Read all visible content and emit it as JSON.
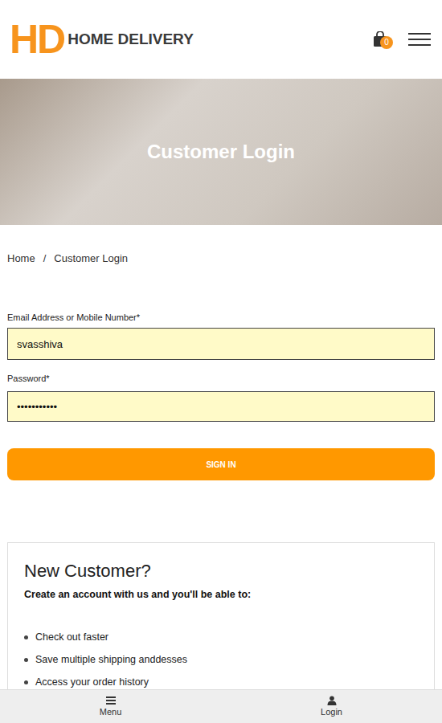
{
  "header": {
    "logo_mark": "HD",
    "brand": "HOME DELIVERY",
    "cart_count": "0"
  },
  "hero": {
    "title": "Customer Login"
  },
  "breadcrumb": {
    "separator": "/",
    "items": [
      {
        "label": "Home"
      },
      {
        "label": "Customer Login"
      }
    ]
  },
  "form": {
    "fields": [
      {
        "label": "Email Address or Mobile Number*",
        "value": "svasshiva"
      },
      {
        "label": "Password*",
        "value": "•••••••••••"
      }
    ],
    "submit": "SIGN IN"
  },
  "new_customer": {
    "title": "New Customer?",
    "subtitle": "Create an account with us and you'll be able to:",
    "benefits": [
      "Check out faster",
      "Save multiple shipping anddesses",
      "Access your order history"
    ]
  },
  "bottom_nav": [
    {
      "label": "Menu",
      "kind": "menu"
    },
    {
      "label": "Login",
      "kind": "user"
    }
  ]
}
